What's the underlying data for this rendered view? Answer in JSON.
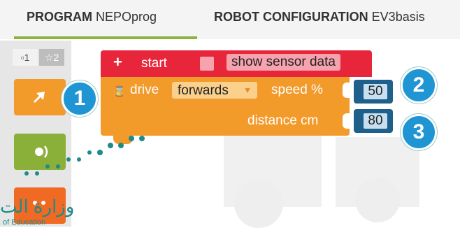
{
  "tabs": {
    "program_bold": "PROGRAM",
    "program_name": "NEPOprog",
    "config_bold": "ROBOT CONFIGURATION",
    "config_name": "EV3basis"
  },
  "toolbox": {
    "level1": "▫1",
    "level2": "☆2"
  },
  "start_block": {
    "plus": "+",
    "label": "start",
    "sensor_label": "show sensor data"
  },
  "drive_block": {
    "hourglass": "⌛",
    "label": "drive",
    "direction": "forwards",
    "speed_label": "speed %",
    "distance_label": "distance cm",
    "speed_value": "50",
    "distance_value": "80"
  },
  "callouts": [
    "1",
    "2",
    "3"
  ],
  "watermark": {
    "arabic": "وزارة الت",
    "english": "of Education"
  },
  "colors": {
    "start_block": "#e8263b",
    "drive_block": "#f29a2a",
    "number_block": "#1f5f8b",
    "callout": "#1f95d3",
    "tab_underline": "#8fb33a"
  }
}
